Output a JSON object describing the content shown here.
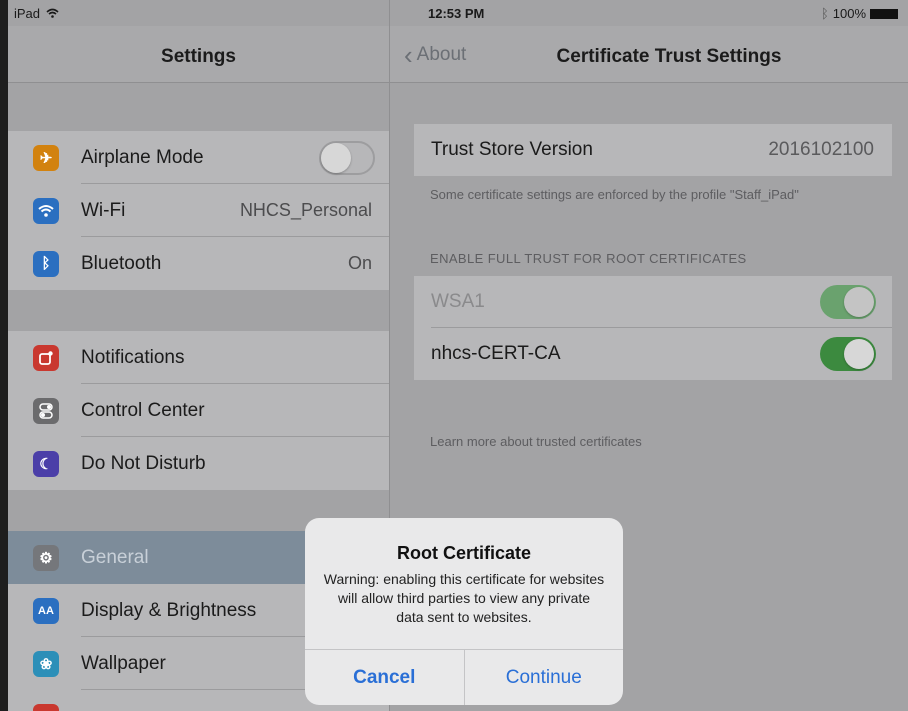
{
  "status_bar": {
    "carrier": "iPad",
    "time": "12:53 PM",
    "battery": "100%"
  },
  "master": {
    "title": "Settings",
    "group1": [
      {
        "icon": "airplane-icon",
        "glyph": "✈",
        "color": "#d2820f",
        "label": "Airplane Mode",
        "toggle": "off"
      },
      {
        "icon": "wifi-icon",
        "glyph": "≈",
        "color": "#2b6fc0",
        "label": "Wi-Fi",
        "value": "NHCS_Personal"
      },
      {
        "icon": "bluetooth-icon",
        "glyph": "ᛒ",
        "color": "#2b6fc0",
        "label": "Bluetooth",
        "value": "On"
      }
    ],
    "group2": [
      {
        "icon": "notifications-icon",
        "glyph": "▢",
        "color": "#c9382f",
        "label": "Notifications"
      },
      {
        "icon": "control-center-icon",
        "glyph": "≡",
        "color": "#6b6b6d",
        "label": "Control Center"
      },
      {
        "icon": "moon-icon",
        "glyph": "☾",
        "color": "#4b3fa8",
        "label": "Do Not Disturb"
      }
    ],
    "group3": [
      {
        "icon": "gear-icon",
        "glyph": "⚙",
        "color": "#75777b",
        "label": "General",
        "selected": true
      },
      {
        "icon": "display-icon",
        "glyph": "AA",
        "color": "#2b6fc0",
        "label": "Display & Brightness"
      },
      {
        "icon": "wallpaper-icon",
        "glyph": "❀",
        "color": "#2c8fb8",
        "label": "Wallpaper"
      }
    ]
  },
  "detail": {
    "back_label": "About",
    "title": "Certificate Trust Settings",
    "trust_store": {
      "label": "Trust Store Version",
      "value": "2016102100"
    },
    "profile_note": "Some certificate settings are enforced by the profile \"Staff_iPad\"",
    "section_header": "ENABLE FULL TRUST FOR ROOT CERTIFICATES",
    "certificates": [
      {
        "label": "WSA1",
        "toggle": "on",
        "disabled": true
      },
      {
        "label": "nhcs-CERT-CA",
        "toggle": "on",
        "disabled": false
      }
    ],
    "learn_more": "Learn more about trusted certificates"
  },
  "alert": {
    "title": "Root Certificate",
    "message": "Warning: enabling this certificate for websites will allow third parties to view any private data sent to websites.",
    "cancel": "Cancel",
    "continue": "Continue"
  }
}
